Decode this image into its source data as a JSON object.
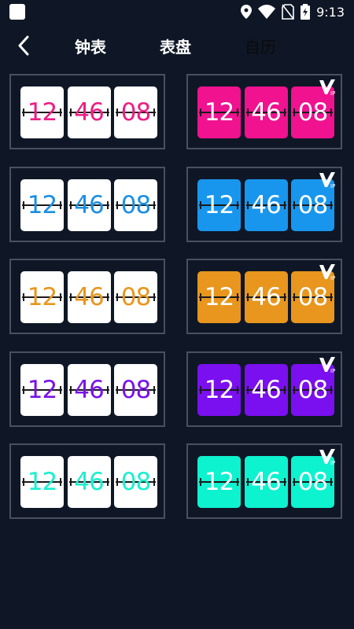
{
  "status": {
    "time": "9:13"
  },
  "nav": {
    "tabs": [
      "钟表",
      "表盘",
      "自历"
    ]
  },
  "clock": {
    "digits": [
      "12",
      "46",
      "08"
    ]
  },
  "vip_label": "VIP",
  "cards": [
    {
      "style": "white",
      "color": "#ec1e85",
      "vip": false
    },
    {
      "style": "filled",
      "color": "#f0128f",
      "vip": true
    },
    {
      "style": "white",
      "color": "#1b8fe3",
      "vip": false
    },
    {
      "style": "filled",
      "color": "#1896ee",
      "vip": true
    },
    {
      "style": "white",
      "color": "#e8961d",
      "vip": false
    },
    {
      "style": "filled",
      "color": "#e8961d",
      "vip": true
    },
    {
      "style": "white",
      "color": "#7a12e8",
      "vip": false
    },
    {
      "style": "filled",
      "color": "#7a0ff0",
      "vip": true
    },
    {
      "style": "white",
      "color": "#1bf0cf",
      "vip": false
    },
    {
      "style": "filled",
      "color": "#0df2cf",
      "vip": true
    }
  ]
}
